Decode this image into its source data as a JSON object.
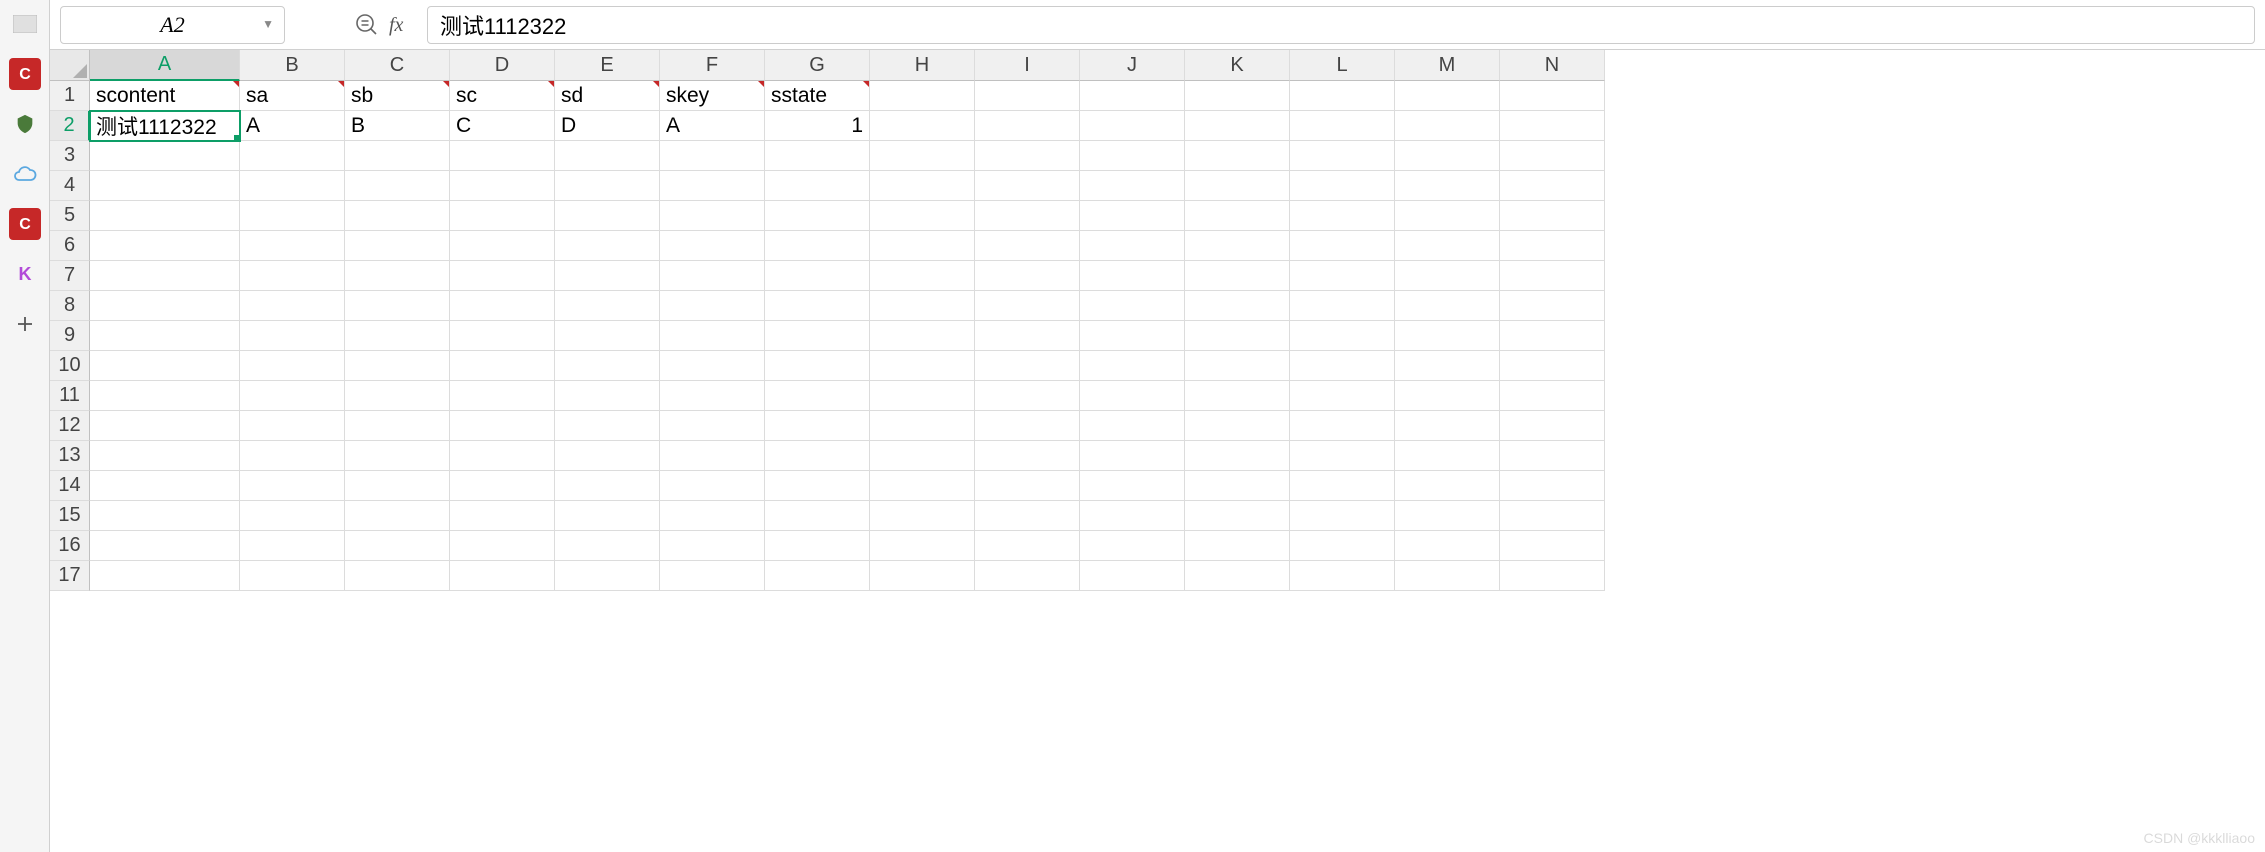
{
  "namebox": {
    "value": "A2"
  },
  "formula": {
    "value": "测试1112322"
  },
  "columns": [
    "A",
    "B",
    "C",
    "D",
    "E",
    "F",
    "G",
    "H",
    "I",
    "J",
    "K",
    "L",
    "M",
    "N"
  ],
  "rows": [
    "1",
    "2",
    "3",
    "4",
    "5",
    "6",
    "7",
    "8",
    "9",
    "10",
    "11",
    "12",
    "13",
    "14",
    "15",
    "16",
    "17"
  ],
  "active": {
    "row": 1,
    "col": 0
  },
  "selected_col": 0,
  "selected_row": 1,
  "cells": {
    "r1": [
      "scontent",
      "sa",
      "sb",
      "sc",
      "sd",
      "skey",
      "sstate",
      "",
      "",
      "",
      "",
      "",
      "",
      ""
    ],
    "r2": [
      "测试1112322",
      "A",
      "B",
      "C",
      "D",
      "A",
      "1",
      "",
      "",
      "",
      "",
      "",
      "",
      ""
    ]
  },
  "comment_marks": {
    "row": 0,
    "cols": [
      0,
      1,
      2,
      3,
      4,
      5,
      6
    ]
  },
  "numeric_cells": [
    {
      "row": 1,
      "col": 6
    }
  ],
  "watermark": "CSDN @kkklliaoo"
}
